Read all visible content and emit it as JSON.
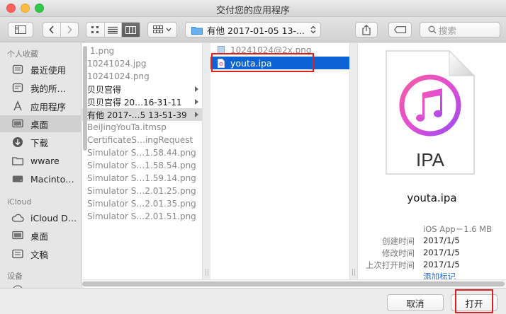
{
  "window": {
    "title": "交付您的应用程序"
  },
  "toolbar": {
    "location": "有他 2017-01-05 13-...",
    "search_placeholder": "搜索"
  },
  "sidebar": {
    "sections": [
      {
        "header": "个人收藏",
        "items": [
          {
            "label": "最近使用",
            "icon": "recents-icon"
          },
          {
            "label": "我的所…",
            "icon": "all-files-icon"
          },
          {
            "label": "应用程序",
            "icon": "applications-icon"
          },
          {
            "label": "桌面",
            "icon": "desktop-icon",
            "selected": true
          },
          {
            "label": "下载",
            "icon": "downloads-icon"
          },
          {
            "label": "wware",
            "icon": "folder-icon"
          },
          {
            "label": "Macinto…",
            "icon": "hard-drive-icon"
          }
        ]
      },
      {
        "header": "iCloud",
        "items": [
          {
            "label": "iCloud D…",
            "icon": "icloud-icon"
          },
          {
            "label": "桌面",
            "icon": "desktop-icon"
          },
          {
            "label": "文稿",
            "icon": "documents-icon"
          }
        ]
      },
      {
        "header": "设备",
        "items": []
      }
    ]
  },
  "column1": {
    "files": [
      {
        "name": "1.png",
        "type": "file"
      },
      {
        "name": "10241024.jpg",
        "type": "file"
      },
      {
        "name": "10241024.png",
        "type": "file"
      },
      {
        "name": "贝贝宫得",
        "type": "folder"
      },
      {
        "name": "贝贝宫得 20…16-31-11",
        "type": "folder"
      },
      {
        "name": "有他 2017-…5 13-51-39",
        "type": "folder",
        "selected": true
      },
      {
        "name": "BeiJingYouTa.itmsp",
        "type": "file"
      },
      {
        "name": "CertificateS…ingRequest",
        "type": "file"
      },
      {
        "name": "Simulator S…1.58.44.png",
        "type": "file"
      },
      {
        "name": "Simulator S…1.58.54.png",
        "type": "file"
      },
      {
        "name": "Simulator S…1.59.14.png",
        "type": "file"
      },
      {
        "name": "Simulator S…2.01.25.png",
        "type": "file"
      },
      {
        "name": "Simulator S…2.01.35.png",
        "type": "file"
      },
      {
        "name": "Simulator S…2.01.51.png",
        "type": "file"
      }
    ]
  },
  "column2": {
    "files": [
      {
        "name": "10241024@2x.png",
        "type": "file"
      },
      {
        "name": "youta.ipa",
        "type": "file",
        "selected": true
      }
    ]
  },
  "preview": {
    "icon_text": "IPA",
    "name": "youta.ipa",
    "kind": "iOS App－1.6 MB",
    "rows": [
      {
        "key": "创建时间",
        "value": "2017/1/5"
      },
      {
        "key": "修改时间",
        "value": "2017/1/5"
      },
      {
        "key": "上次打开时间",
        "value": "2017/1/5"
      }
    ],
    "add_tags": "添加标记"
  },
  "buttons": {
    "cancel": "取消",
    "open": "打开"
  },
  "colors": {
    "selection": "#0d63d6",
    "annotation": "#e02020",
    "itunes_gradient_start": "#f45ca3",
    "itunes_gradient_end": "#9a4cf0"
  }
}
